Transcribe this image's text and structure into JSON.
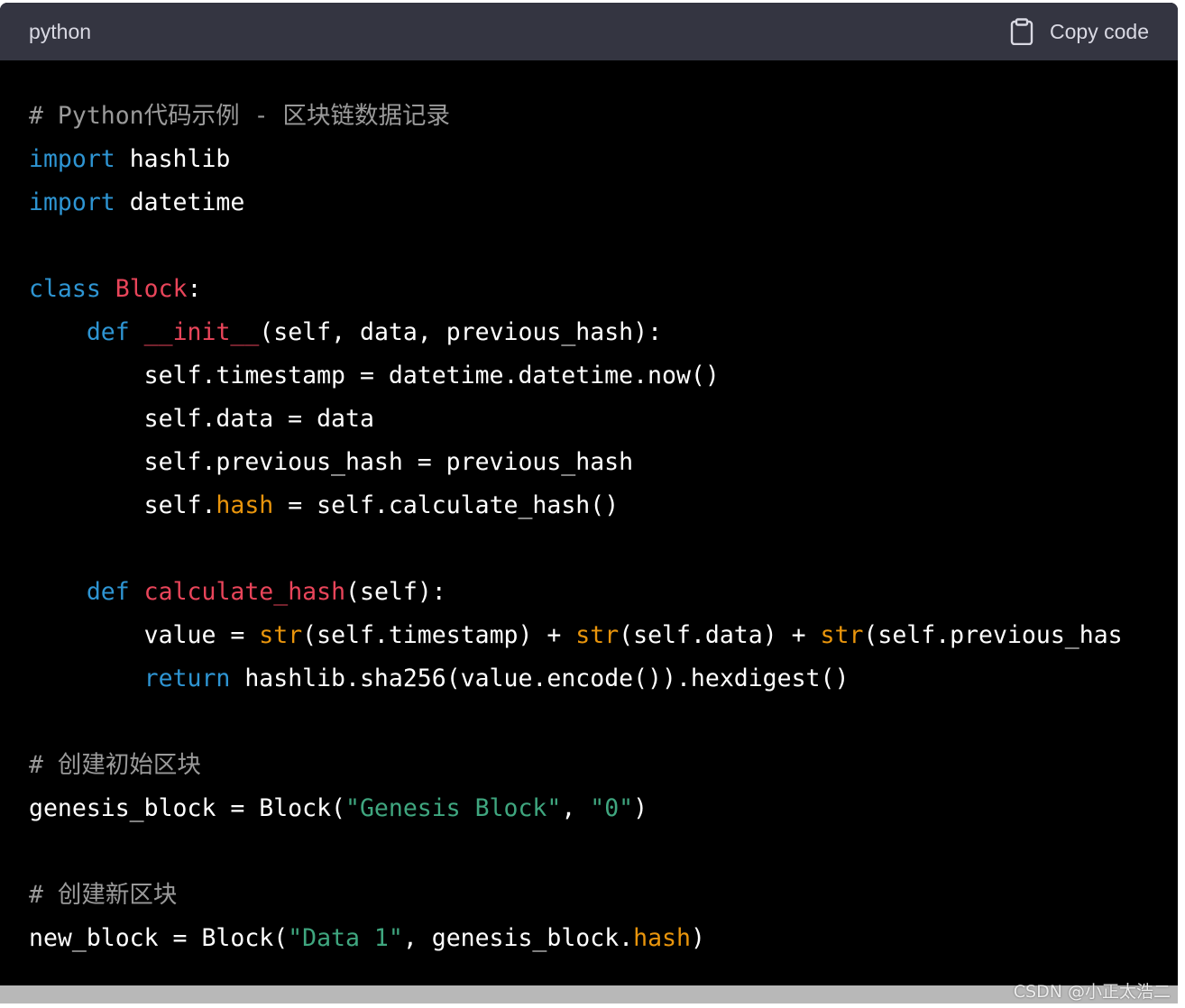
{
  "header": {
    "language": "python",
    "copy_label": "Copy code",
    "copy_icon": "clipboard-icon"
  },
  "code": {
    "lines": [
      [
        {
          "t": "# Python代码示例 - 区块链数据记录",
          "c": "com"
        }
      ],
      [
        {
          "t": "import",
          "c": "kw"
        },
        {
          "t": " hashlib",
          "c": ""
        }
      ],
      [
        {
          "t": "import",
          "c": "kw"
        },
        {
          "t": " datetime",
          "c": ""
        }
      ],
      [],
      [
        {
          "t": "class",
          "c": "kw"
        },
        {
          "t": " ",
          "c": ""
        },
        {
          "t": "Block",
          "c": "cls"
        },
        {
          "t": ":",
          "c": ""
        }
      ],
      [
        {
          "t": "    ",
          "c": ""
        },
        {
          "t": "def",
          "c": "kw"
        },
        {
          "t": " ",
          "c": ""
        },
        {
          "t": "__init__",
          "c": "fn"
        },
        {
          "t": "(self, data, previous_hash):",
          "c": ""
        }
      ],
      [
        {
          "t": "        self.timestamp = datetime.datetime.now()",
          "c": ""
        }
      ],
      [
        {
          "t": "        self.data = data",
          "c": ""
        }
      ],
      [
        {
          "t": "        self.previous_hash = previous_hash",
          "c": ""
        }
      ],
      [
        {
          "t": "        self.",
          "c": ""
        },
        {
          "t": "hash",
          "c": "bi"
        },
        {
          "t": " = self.calculate_hash()",
          "c": ""
        }
      ],
      [],
      [
        {
          "t": "    ",
          "c": ""
        },
        {
          "t": "def",
          "c": "kw"
        },
        {
          "t": " ",
          "c": ""
        },
        {
          "t": "calculate_hash",
          "c": "fn"
        },
        {
          "t": "(self):",
          "c": ""
        }
      ],
      [
        {
          "t": "        value = ",
          "c": ""
        },
        {
          "t": "str",
          "c": "bi"
        },
        {
          "t": "(self.timestamp) + ",
          "c": ""
        },
        {
          "t": "str",
          "c": "bi"
        },
        {
          "t": "(self.data) + ",
          "c": ""
        },
        {
          "t": "str",
          "c": "bi"
        },
        {
          "t": "(self.previous_has",
          "c": ""
        }
      ],
      [
        {
          "t": "        ",
          "c": ""
        },
        {
          "t": "return",
          "c": "kw"
        },
        {
          "t": " hashlib.sha256(value.encode()).hexdigest()",
          "c": ""
        }
      ],
      [],
      [
        {
          "t": "# 创建初始区块",
          "c": "com"
        }
      ],
      [
        {
          "t": "genesis_block = Block(",
          "c": ""
        },
        {
          "t": "\"Genesis Block\"",
          "c": "str"
        },
        {
          "t": ", ",
          "c": ""
        },
        {
          "t": "\"0\"",
          "c": "str"
        },
        {
          "t": ")",
          "c": ""
        }
      ],
      [],
      [
        {
          "t": "# 创建新区块",
          "c": "com"
        }
      ],
      [
        {
          "t": "new_block = Block(",
          "c": ""
        },
        {
          "t": "\"Data 1\"",
          "c": "str"
        },
        {
          "t": ", genesis_block.",
          "c": ""
        },
        {
          "t": "hash",
          "c": "bi"
        },
        {
          "t": ")",
          "c": ""
        }
      ]
    ]
  },
  "watermark": "CSDN @小正太浩二",
  "colors": {
    "header_bg": "#343541",
    "code_bg": "#000000",
    "keyword": "#2e95d3",
    "class_name": "#e9455a",
    "builtin": "#e9950c",
    "string": "#3fa67f",
    "comment": "#9a9a9a"
  }
}
